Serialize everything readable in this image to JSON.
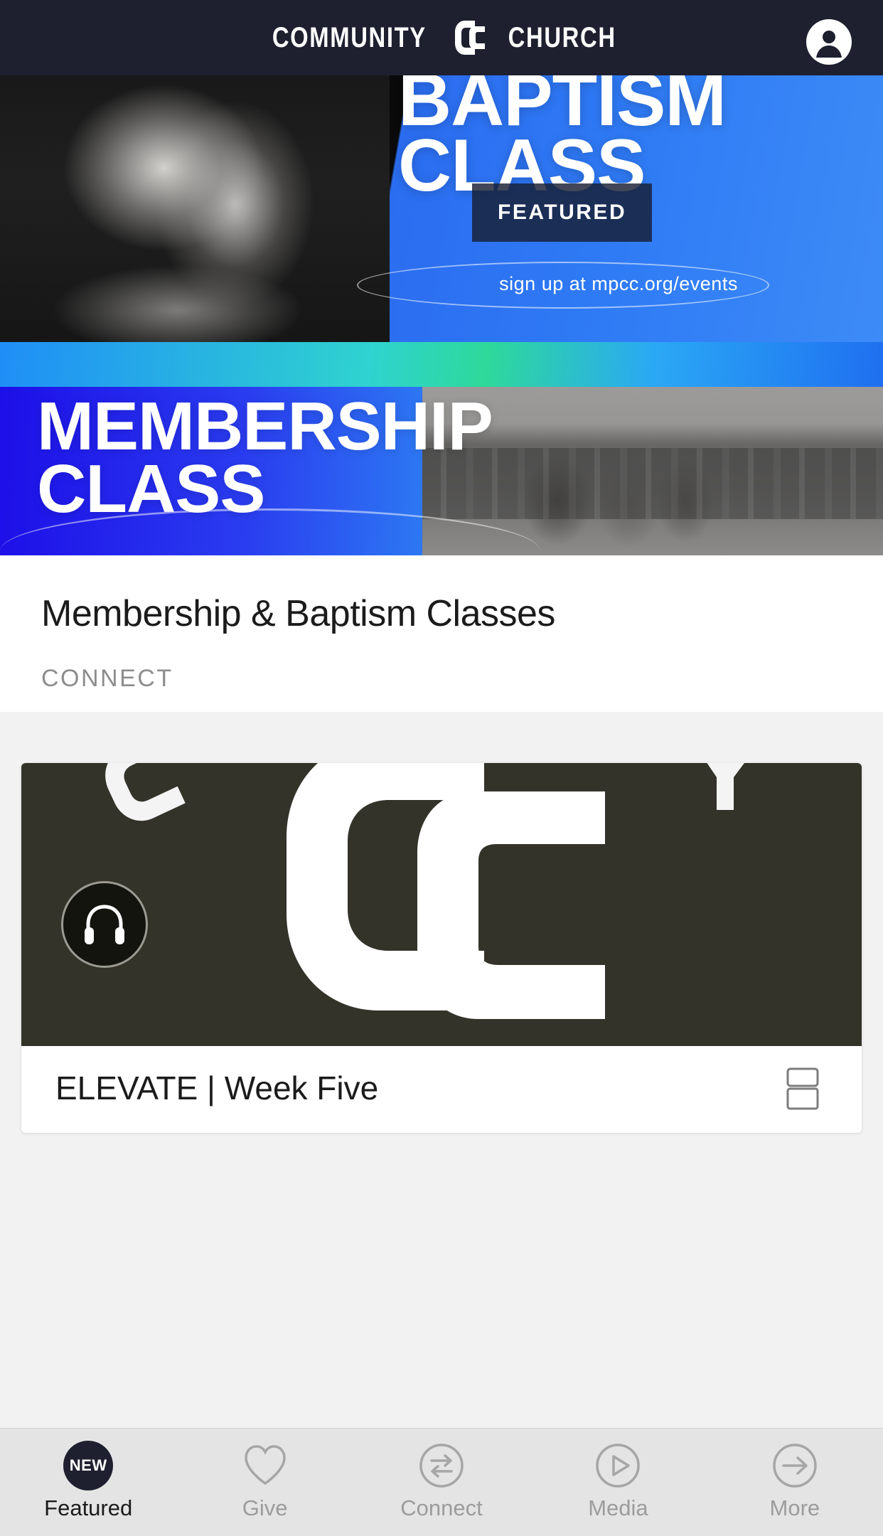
{
  "header": {
    "brand_word_left": "COMMUNITY",
    "brand_word_right": "CHURCH",
    "logo_icon": "cc-monogram-icon",
    "avatar_icon": "user-avatar-icon"
  },
  "hero": {
    "badge_label": "FEATURED",
    "baptism_banner": {
      "line1": "BAPTISM",
      "line2": "CLASS",
      "signup_text": "sign up at mpcc.org/events"
    },
    "membership_banner": {
      "line1": "MEMBERSHIP",
      "line2": "CLASS"
    }
  },
  "featured_item": {
    "title": "Membership & Baptism Classes",
    "category": "CONNECT"
  },
  "media_card": {
    "title": "ELEVATE | Week Five",
    "audio_icon": "headphones-icon",
    "bookmark_icon": "bookmark-icon",
    "thumb_logo_icon": "cc-monogram-icon"
  },
  "tabbar": {
    "items": [
      {
        "label": "Featured",
        "icon": "new-badge-icon",
        "badge_text": "NEW",
        "active": true
      },
      {
        "label": "Give",
        "icon": "heart-icon",
        "active": false
      },
      {
        "label": "Connect",
        "icon": "exchange-arrows-icon",
        "active": false
      },
      {
        "label": "Media",
        "icon": "play-circle-icon",
        "active": false
      },
      {
        "label": "More",
        "icon": "arrow-right-circle-icon",
        "active": false
      }
    ]
  },
  "colors": {
    "header_bg": "#1e2030",
    "accent_blue": "#2b6df0",
    "cyan": "#2ec9f2",
    "card_dark": "#33332a",
    "tabbar_bg": "#e4e4e4",
    "muted_text": "#8d8d8d"
  }
}
